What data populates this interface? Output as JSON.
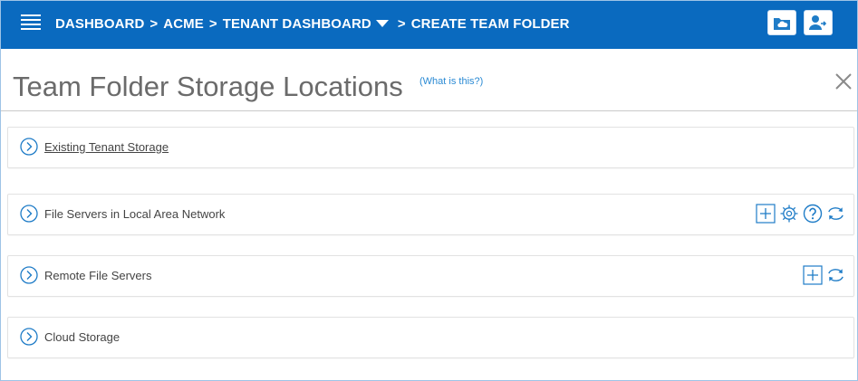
{
  "colors": {
    "topbar": "#0a6abf",
    "accent": "#1f7cc7",
    "title": "#6b6b6b"
  },
  "topbar": {
    "menu_icon": "hamburger-icon",
    "breadcrumb": {
      "items": [
        "DASHBOARD",
        "ACME",
        "TENANT DASHBOARD",
        "CREATE TEAM FOLDER"
      ],
      "separator": ">"
    },
    "right_icons": [
      "cloud-folder-icon",
      "user-switch-icon"
    ]
  },
  "header": {
    "title": "Team Folder Storage Locations",
    "help_link": "(What is this?)",
    "close_icon": "close-icon"
  },
  "panels": [
    {
      "label": "Existing Tenant Storage",
      "underlined": true,
      "actions": []
    },
    {
      "label": "File Servers in Local Area Network",
      "actions": [
        "add-icon",
        "settings-gear-icon",
        "help-icon",
        "refresh-icon"
      ]
    },
    {
      "label": "Remote File Servers",
      "actions": [
        "add-icon",
        "refresh-icon"
      ]
    },
    {
      "label": "Cloud Storage",
      "actions": []
    }
  ]
}
